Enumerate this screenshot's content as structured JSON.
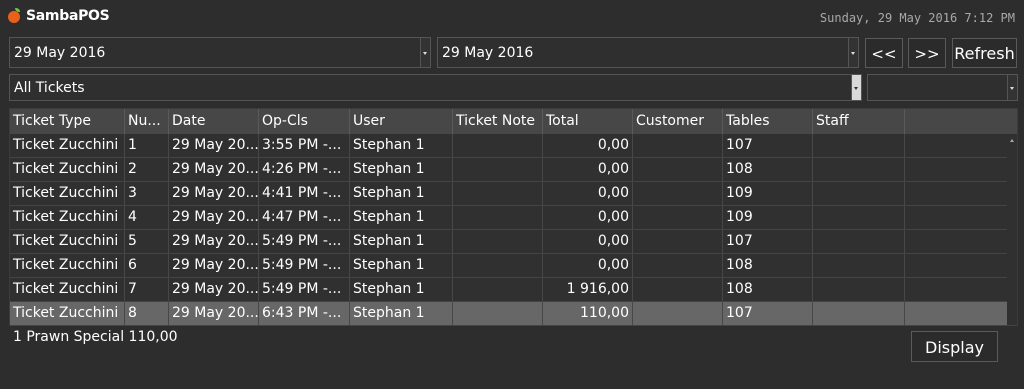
{
  "app": {
    "title": "SambaPOS",
    "clock": "Sunday, 29 May 2016 7:12 PM"
  },
  "filters": {
    "start_date": "29 May 2016",
    "end_date": "29 May 2016",
    "prev_label": "<<",
    "next_label": ">>",
    "refresh_label": "Refresh",
    "ticket_filter": "All Tickets",
    "secondary_filter": ""
  },
  "table": {
    "columns": [
      "Ticket Type",
      "Nu...",
      "Date",
      "Op-Cls",
      "User",
      "Ticket Note",
      "Total",
      "Customer",
      "Tables",
      "Staff"
    ],
    "rows": [
      [
        "Ticket Zucchini",
        "1",
        "29 May 20...",
        "3:55 PM -...",
        "Stephan 1",
        "",
        "0,00",
        "",
        "107",
        ""
      ],
      [
        "Ticket Zucchini",
        "2",
        "29 May 20...",
        "4:26 PM -...",
        "Stephan 1",
        "",
        "0,00",
        "",
        "108",
        ""
      ],
      [
        "Ticket Zucchini",
        "3",
        "29 May 20...",
        "4:41 PM -...",
        "Stephan 1",
        "",
        "0,00",
        "",
        "109",
        ""
      ],
      [
        "Ticket Zucchini",
        "4",
        "29 May 20...",
        "4:47 PM -...",
        "Stephan 1",
        "",
        "0,00",
        "",
        "109",
        ""
      ],
      [
        "Ticket Zucchini",
        "5",
        "29 May 20...",
        "5:49 PM -...",
        "Stephan 1",
        "",
        "0,00",
        "",
        "107",
        ""
      ],
      [
        "Ticket Zucchini",
        "6",
        "29 May 20...",
        "5:49 PM -...",
        "Stephan 1",
        "",
        "0,00",
        "",
        "108",
        ""
      ],
      [
        "Ticket Zucchini",
        "7",
        "29 May 20...",
        "5:49 PM -...",
        "Stephan 1",
        "",
        "1 916,00",
        "",
        "108",
        ""
      ],
      [
        "Ticket Zucchini",
        "8",
        "29 May 20...",
        "6:43 PM -...",
        "Stephan 1",
        "",
        "110,00",
        "",
        "107",
        ""
      ]
    ],
    "selected_row": 8
  },
  "details": {
    "order_line": "1 Prawn Special 110,00",
    "display_label": "Display"
  },
  "colors": {
    "background": "#2d2d2d",
    "header": "#474747",
    "selected": "#676767",
    "logo": "#e8601c"
  }
}
